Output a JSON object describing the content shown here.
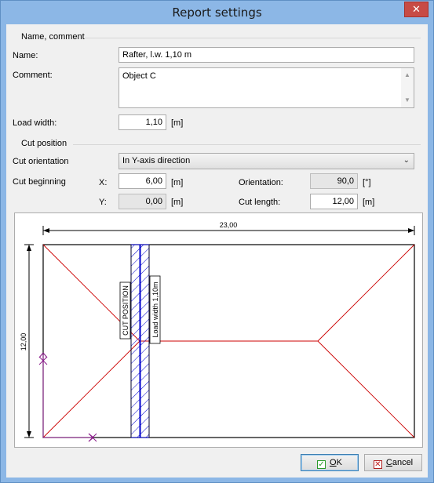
{
  "window": {
    "title": "Report settings",
    "close_glyph": "✕"
  },
  "name_comment": {
    "group_title": "Name, comment",
    "name_label": "Name:",
    "name_value": "Rafter, l.w. 1,10 m",
    "comment_label": "Comment:",
    "comment_value": "Object C",
    "load_width_label": "Load width:",
    "load_width_value": "1,10",
    "load_width_unit": "[m]"
  },
  "cut_position": {
    "group_title": "Cut position",
    "orientation_label": "Cut orientation",
    "orientation_value": "In Y-axis direction",
    "beginning_label": "Cut beginning",
    "x_label": "X:",
    "x_value": "6,00",
    "x_unit": "[m]",
    "y_label": "Y:",
    "y_value": "0,00",
    "y_unit": "[m]",
    "orientation_angle_label": "Orientation:",
    "orientation_angle_value": "90,0",
    "orientation_angle_unit": "[°]",
    "cut_length_label": "Cut length:",
    "cut_length_value": "12,00",
    "cut_length_unit": "[m]"
  },
  "drawing": {
    "width_dim": "23,00",
    "height_dim": "12,00",
    "cut_position_text": "CUT POSITION",
    "load_width_text": "Load width 1,10m",
    "roof_line_color": "#cc0000",
    "cut_band_color": "#0000cc"
  },
  "buttons": {
    "ok_prefix": "",
    "ok_underlined": "O",
    "ok_rest": "K",
    "cancel_underlined": "C",
    "cancel_rest": "ancel"
  }
}
